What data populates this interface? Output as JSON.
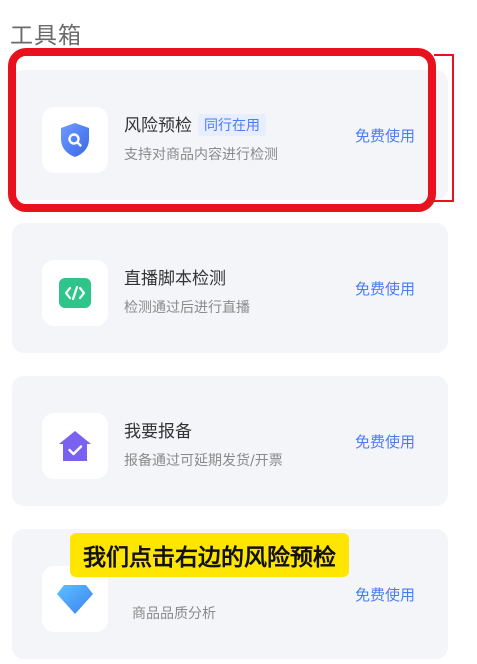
{
  "section": {
    "title": "工具箱"
  },
  "tools": [
    {
      "title": "风险预检",
      "badge": "同行在用",
      "desc": "支持对商品内容进行检测",
      "action": "免费使用",
      "icon": "shield-search-icon",
      "color": "#4a7cf5"
    },
    {
      "title": "直播脚本检测",
      "desc": "检测通过后进行直播",
      "action": "免费使用",
      "icon": "code-icon",
      "color": "#2fc58a"
    },
    {
      "title": "我要报备",
      "desc": "报备通过可延期发货/开票",
      "action": "免费使用",
      "icon": "house-check-icon",
      "color": "#7b61f0"
    },
    {
      "title": "",
      "desc": "商品品质分析",
      "action": "免费使用",
      "icon": "diamond-icon",
      "color": "#3b9cf0"
    }
  ],
  "caption": {
    "text": "我们点击右边的风险预检"
  },
  "colors": {
    "accent": "#4a7cf5",
    "highlight": "#e8111d",
    "caption_bg": "#ffe600"
  }
}
